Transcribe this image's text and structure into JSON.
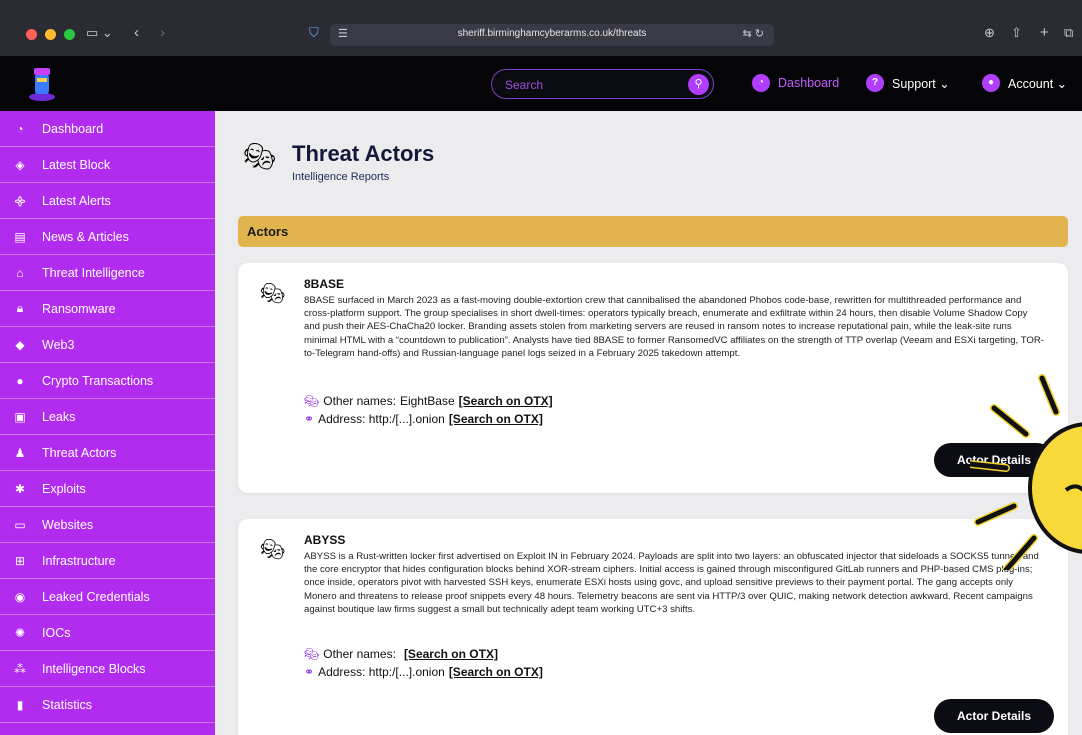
{
  "browser": {
    "url": "sheriff.birminghamcyberarms.co.uk/threats"
  },
  "header": {
    "search_placeholder": "Search",
    "nav": [
      {
        "label": "Dashboard",
        "icon": "dashboard-icon"
      },
      {
        "label": "Support ⌄",
        "icon": "question-icon"
      },
      {
        "label": "Account ⌄",
        "icon": "user-icon"
      }
    ]
  },
  "sidebar": {
    "items": [
      {
        "label": "Dashboard",
        "icon": "dashboard-icon"
      },
      {
        "label": "Latest Block",
        "icon": "cube-icon"
      },
      {
        "label": "Latest Alerts",
        "icon": "broadcast-icon"
      },
      {
        "label": "News & Articles",
        "icon": "newspaper-icon"
      },
      {
        "label": "Threat Intelligence",
        "icon": "building-icon"
      },
      {
        "label": "Ransomware",
        "icon": "lock-icon"
      },
      {
        "label": "Web3",
        "icon": "ethereum-icon"
      },
      {
        "label": "Crypto Transactions",
        "icon": "coin-icon"
      },
      {
        "label": "Leaks",
        "icon": "floppy-icon"
      },
      {
        "label": "Threat Actors",
        "icon": "user-secret-icon"
      },
      {
        "label": "Exploits",
        "icon": "bug-icon"
      },
      {
        "label": "Websites",
        "icon": "browser-icon"
      },
      {
        "label": "Infrastructure",
        "icon": "network-icon"
      },
      {
        "label": "Leaked Credentials",
        "icon": "eye-icon"
      },
      {
        "label": "IOCs",
        "icon": "virus-icon"
      },
      {
        "label": "Intelligence Blocks",
        "icon": "blocks-icon"
      },
      {
        "label": "Statistics",
        "icon": "bar-chart-icon"
      }
    ]
  },
  "page": {
    "title": "Threat Actors",
    "subtitle": "Intelligence Reports",
    "section": "Actors"
  },
  "actors": [
    {
      "name": "8BASE",
      "description": "8BASE surfaced in March 2023 as a fast-moving double-extortion crew that cannibalised the abandoned Phobos code-base, rewritten for multithreaded performance and cross-platform support. The group specialises in short dwell-times: operators typically breach, enumerate and exfiltrate within 24 hours, then disable Volume Shadow Copy and push their AES-ChaCha20 locker. Branding assets stolen from marketing servers are reused in ransom notes to increase reputational pain, while the leak-site runs minimal HTML with a “countdown to publication”. Analysts have tied 8BASE to former RansomedVC affiliates on the strength of TTP overlap (Veeam and ESXi targeting, TOR-to-Telegram hand-offs) and Russian-language panel logs seized in a February 2025 takedown attempt.",
      "other_names_label": "Other names:",
      "other_names": "EightBase",
      "address_label": "Address: http:/[...].onion",
      "otx_link": "[Search on OTX]",
      "button": "Actor Details"
    },
    {
      "name": "ABYSS",
      "description": "ABYSS is a Rust-written locker first advertised on Exploit IN in February 2024. Payloads are split into two layers: an obfuscated injector that sideloads a SOCKS5 tunnel, and the core encryptor that hides configuration blocks behind XOR-stream ciphers. Initial access is gained through misconfigured GitLab runners and PHP-based CMS plug-ins; once inside, operators pivot with harvested SSH keys, enumerate ESXi hosts using govc, and upload sensitive previews to their payment portal. The gang accepts only Monero and threatens to release proof snippets every 48 hours. Telemetry beacons are sent via HTTP/3 over QUIC, making network detection awkward. Recent campaigns against boutique law firms suggest a small but technically adept team working UTC+3 shifts.",
      "other_names_label": "Other names:",
      "other_names": "",
      "address_label": "Address: http:/[...].onion",
      "otx_link": "[Search on OTX]",
      "button": "Actor Details"
    }
  ]
}
